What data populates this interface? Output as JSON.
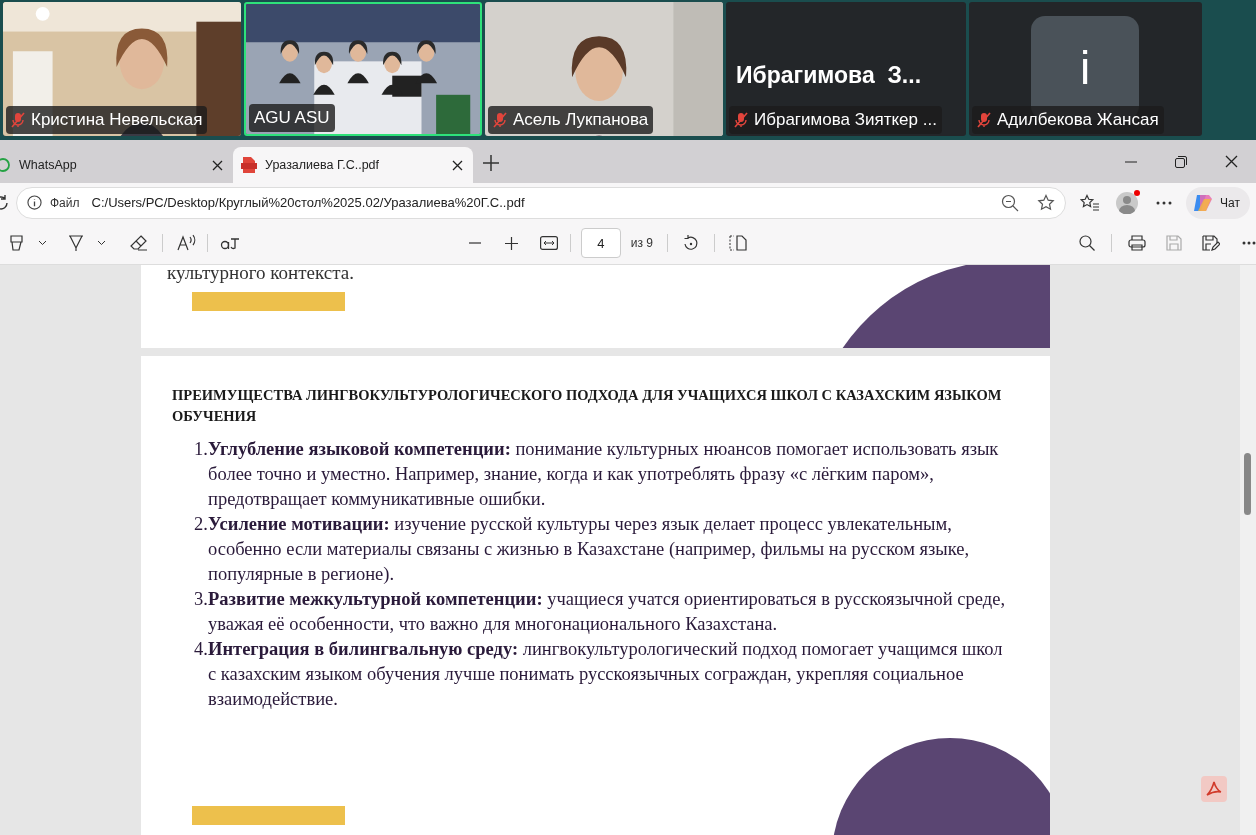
{
  "participants": [
    {
      "name": "Кристина Невельская",
      "kind": "video",
      "muted": true,
      "selected": false
    },
    {
      "name": "AGU ASU",
      "kind": "group_video",
      "muted": false,
      "selected": true
    },
    {
      "name": "Асель Лукпанова",
      "kind": "video",
      "muted": true,
      "selected": false
    },
    {
      "name": "Ибрагимова Зияткер ...",
      "kind": "name_card",
      "display_name": "Ибрагимова  З...",
      "muted": true,
      "selected": false
    },
    {
      "name": "Адилбекова Жансая",
      "kind": "avatar",
      "avatar_letter": "i",
      "muted": true,
      "selected": false
    }
  ],
  "tabs": [
    {
      "title": "WhatsApp",
      "kind": "whatsapp",
      "selected": false
    },
    {
      "title": "Уразалиева Г.С..pdf",
      "kind": "pdf",
      "selected": true
    }
  ],
  "address_bar": {
    "label": "Файл",
    "url": "C:/Users/PC/Desktop/Круглый%20стол%2025.02/Уразалиева%20Г.С..pdf"
  },
  "profile": {
    "notification": true
  },
  "chat_button": "Чат",
  "pdf_toolbar": {
    "page_number": "4",
    "page_count": "из 9"
  },
  "document": {
    "previous_page_text": "культурного контекста.",
    "heading": "ПРЕИМУЩЕСТВА ЛИНГВОКУЛЬТУРОЛОГИЧЕСКОГО ПОДХОДА ДЛЯ УЧАЩИХСЯ ШКОЛ С КАЗАХСКИМ ЯЗЫКОМ ОБУЧЕНИЯ",
    "items": [
      {
        "number": "1.",
        "text": "**Углубление языковой компетенции:** понимание культурных нюансов помогает использовать язык более точно и уместно. Например, знание, когда и как употреблять фразу «с лёгким паром», предотвращает коммуникативные ошибки."
      },
      {
        "number": "2.",
        "text": "**Усиление мотивации:** изучение русской культуры через язык делает процесс увлекательным, особенно если материалы связаны с жизнью в Казахстане (например, фильмы на русском языке, популярные в регионе)."
      },
      {
        "number": "3.",
        "text": "**Развитие межкультурной компетенции:** учащиеся учатся ориентироваться в русскоязычной среде, уважая её особенности, что важно для многонационального Казахстана."
      },
      {
        "number": "4.",
        "text": "**Интеграция в билингвальную среду:** лингвокультурологический подход помогает учащимся школ с казахским языком обучения лучше понимать русскоязычных сограждан, укрепляя социальное взаимодействие."
      }
    ]
  }
}
